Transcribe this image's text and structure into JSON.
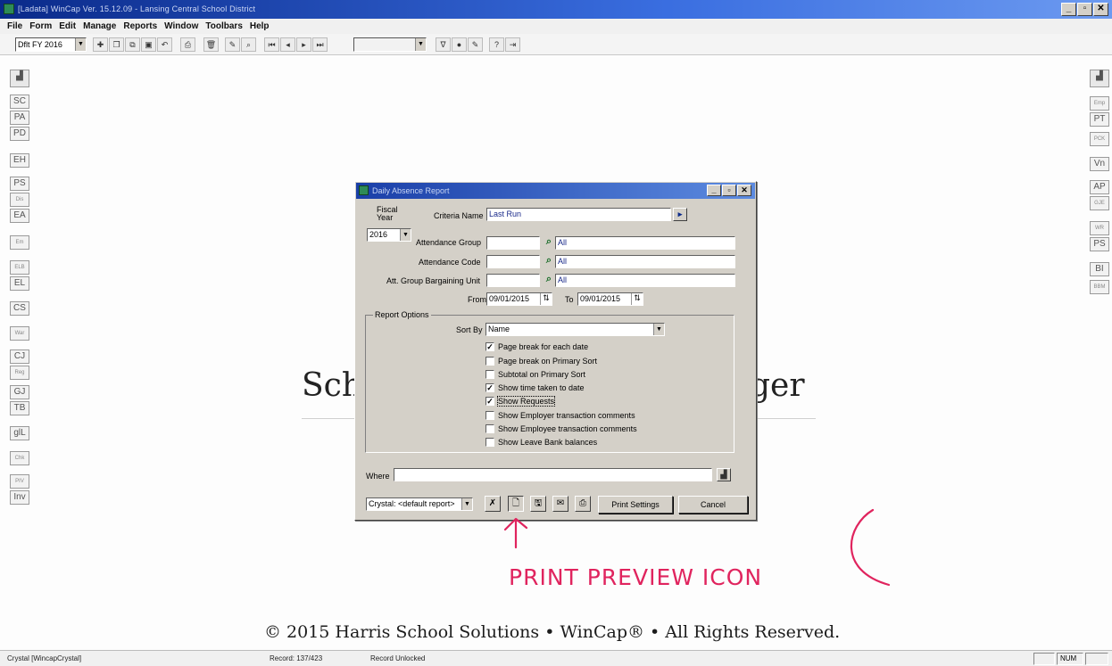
{
  "window": {
    "title": "[Ladata] WinCap Ver. 15.12.09 - Lansing Central School District",
    "buttons": [
      "_",
      "▫",
      "✕"
    ]
  },
  "menu": [
    "File",
    "Form",
    "Edit",
    "Manage",
    "Reports",
    "Window",
    "Toolbars",
    "Help"
  ],
  "toolbar": {
    "fiscal_select": "Dflt FY 2016"
  },
  "sidebar_left": [
    "SC",
    "PA",
    "PD",
    "EH",
    "PS",
    "Dis",
    "EA",
    "Em",
    "ELB",
    "EL",
    "CS",
    "War",
    "CJ",
    "Reg",
    "GJ",
    "TB",
    "glL",
    "Chk",
    "PIV",
    "Inv"
  ],
  "sidebar_right": [
    "Emp",
    "PT",
    "PCK",
    "Vn",
    "AP",
    "GJE",
    "WR",
    "PS",
    "BI",
    "BBM"
  ],
  "background": {
    "word_left": "Sch",
    "word_right": "ger",
    "copyright": "© 2015 Harris School Solutions • WinCap® • All Rights Reserved."
  },
  "dialog": {
    "title": "Daily Absence Report",
    "fiscal_year_label": "Fiscal Year",
    "fiscal_year_value": "2016",
    "criteria_name_label": "Criteria Name",
    "criteria_name_value": "Last Run",
    "attendance_group_label": "Attendance Group",
    "attendance_group_value": "All",
    "attendance_code_label": "Attendance Code",
    "attendance_code_value": "All",
    "att_group_bu_label": "Att. Group Bargaining Unit",
    "att_group_bu_value": "All",
    "from_label": "From",
    "from_value": "09/01/2015",
    "to_label": "To",
    "to_value": "09/01/2015",
    "report_options_label": "Report Options",
    "sort_by_label": "Sort By",
    "sort_by_value": "Name",
    "options": [
      {
        "label": "Page break for each date",
        "checked": true
      },
      {
        "label": "Page break on Primary Sort",
        "checked": false
      },
      {
        "label": "Subtotal on Primary Sort",
        "checked": false
      },
      {
        "label": "Show time taken to date",
        "checked": true
      },
      {
        "label": "Show Requests",
        "checked": true
      },
      {
        "label": "Show Employer transaction comments",
        "checked": false
      },
      {
        "label": "Show Employee transaction comments",
        "checked": false
      },
      {
        "label": "Show Leave Bank balances",
        "checked": false
      }
    ],
    "where_label": "Where",
    "where_value": "",
    "output_select": "Crystal: <default report>",
    "print_settings_label": "Print Settings",
    "cancel_label": "Cancel"
  },
  "annotation": {
    "text": "PRINT PREVIEW ICON",
    "color": "#e0245e"
  },
  "status": {
    "app": "Crystal [WincapCrystal]",
    "record": "Record: 137/423",
    "lock": "Record Unlocked",
    "num": "NUM"
  }
}
